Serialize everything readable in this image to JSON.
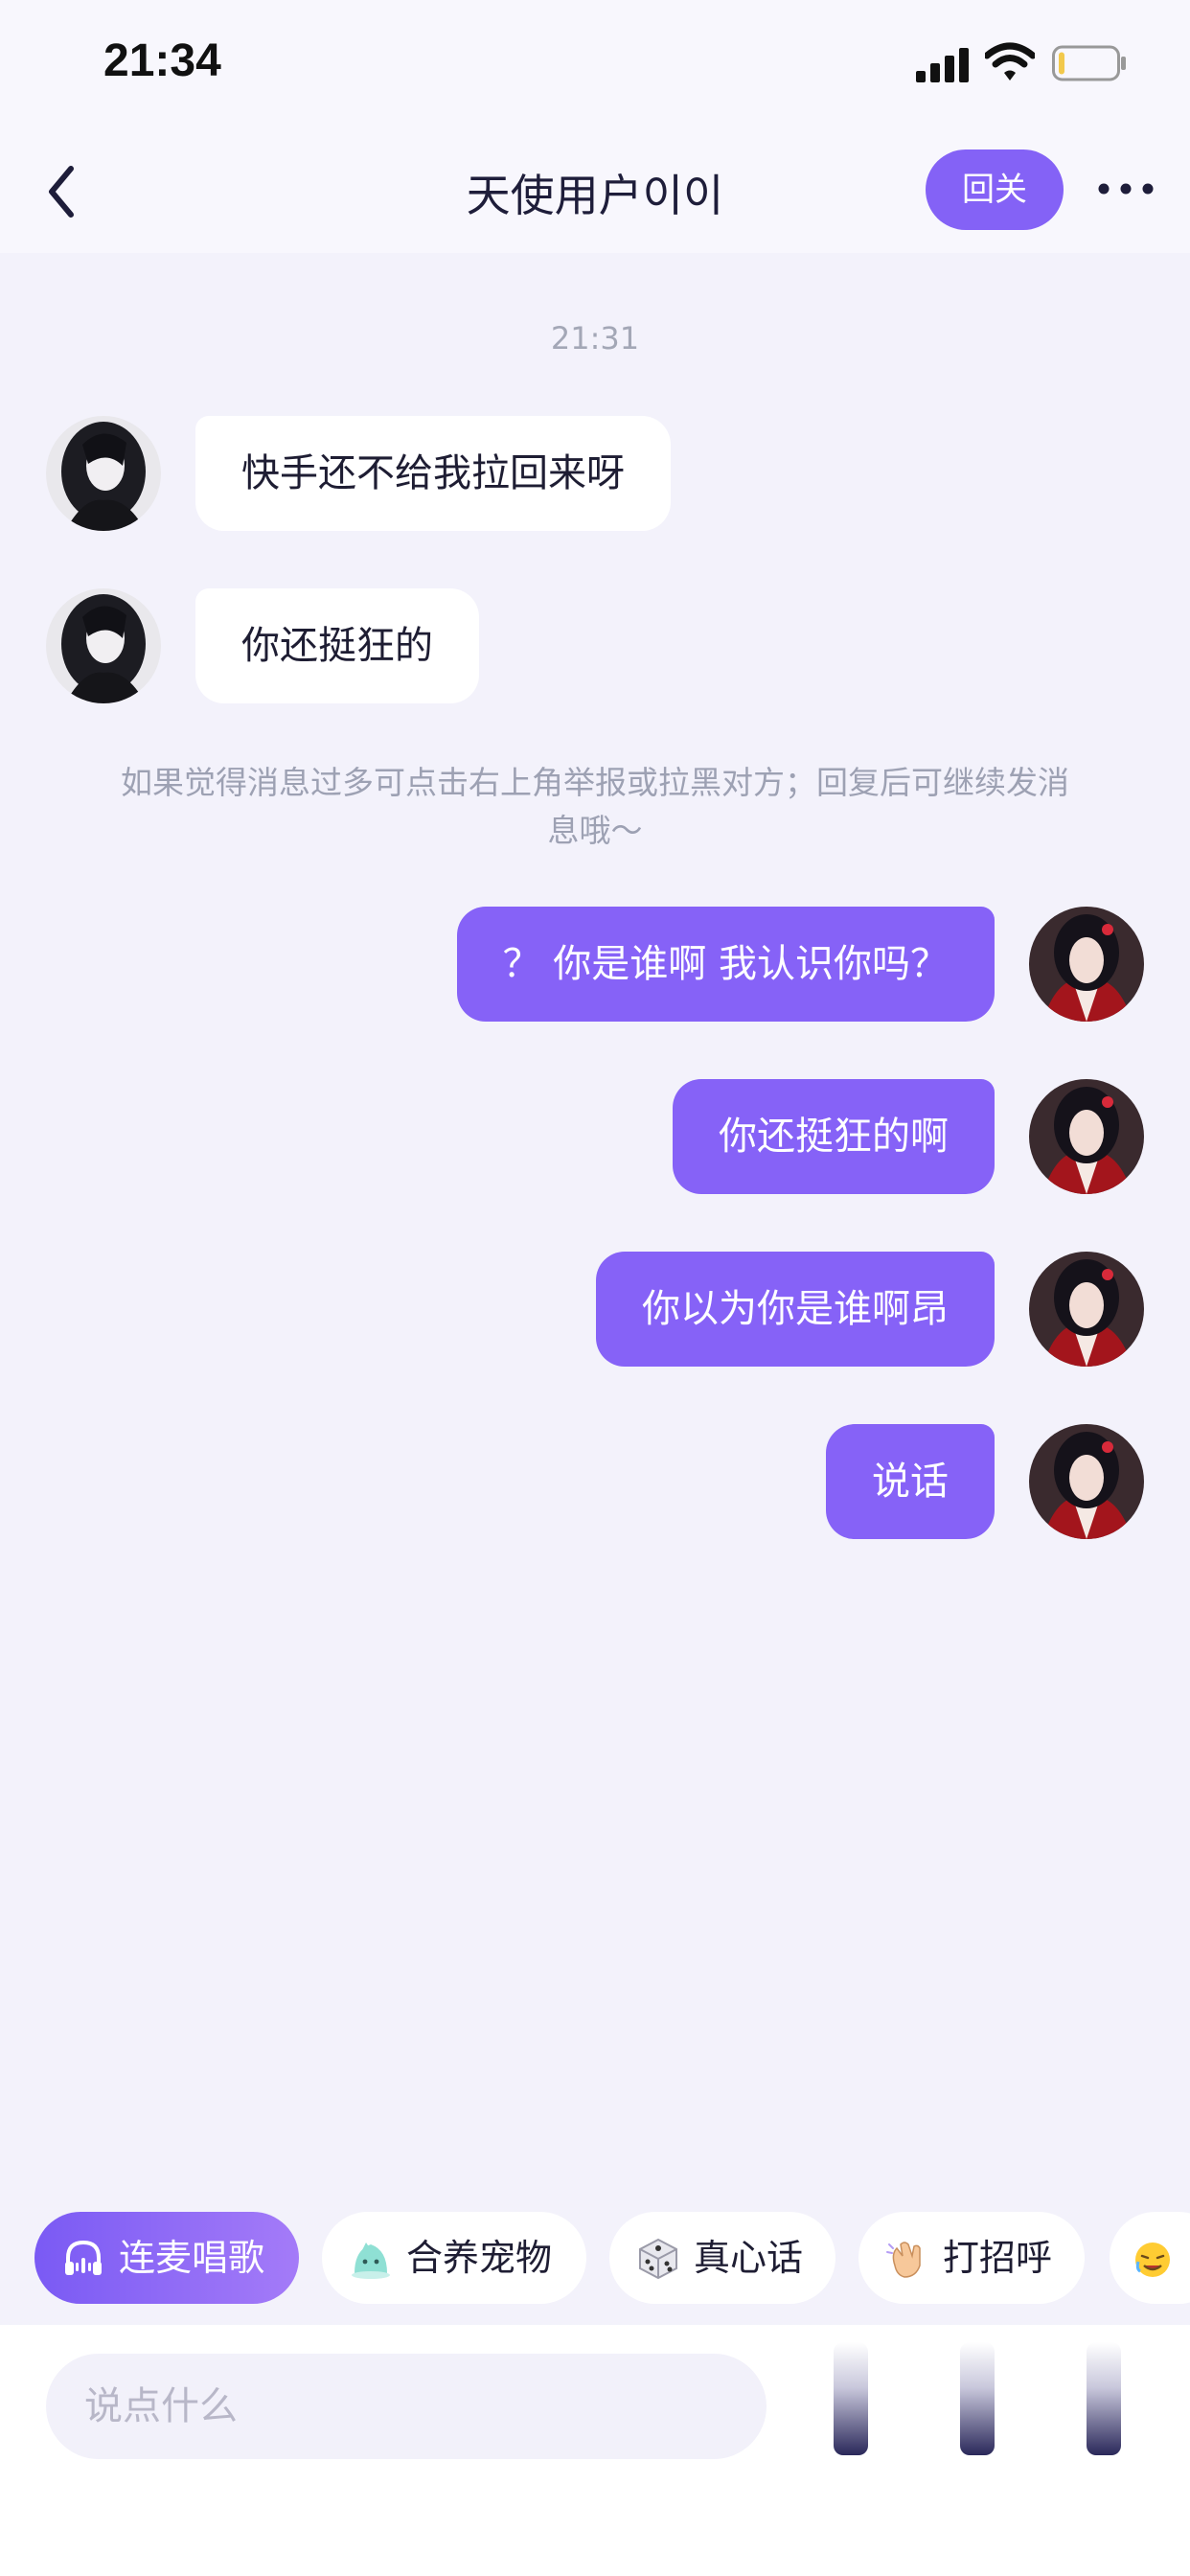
{
  "status_bar": {
    "time": "21:34"
  },
  "header": {
    "title": "天使用户이이",
    "follow_label": "回关"
  },
  "chat": {
    "timestamp": "21:31",
    "notice": "如果觉得消息过多可点击右上角举报或拉黑对方；回复后可继续发消息哦～",
    "messages": [
      {
        "side": "left",
        "text": "快手还不给我拉回来呀"
      },
      {
        "side": "left",
        "text": "你还挺狂的"
      },
      {
        "side": "right",
        "text": "？ 你是谁啊 我认识你吗？"
      },
      {
        "side": "right",
        "text": "你还挺狂的啊"
      },
      {
        "side": "right",
        "text": "你以为你是谁啊昂"
      },
      {
        "side": "right",
        "text": "说话"
      }
    ]
  },
  "quick_actions": [
    {
      "label": "连麦唱歌",
      "icon": "headphones-icon"
    },
    {
      "label": "合养宠物",
      "icon": "pet-icon"
    },
    {
      "label": "真心话",
      "icon": "dice-icon"
    },
    {
      "label": "打招呼",
      "icon": "wave-hand-icon"
    },
    {
      "label": "",
      "icon": "emoji-icon"
    }
  ],
  "composer": {
    "placeholder": "说点什么"
  },
  "colors": {
    "accent": "#8662f7",
    "background": "#f3f2fb",
    "bubble_left": "#ffffff"
  }
}
